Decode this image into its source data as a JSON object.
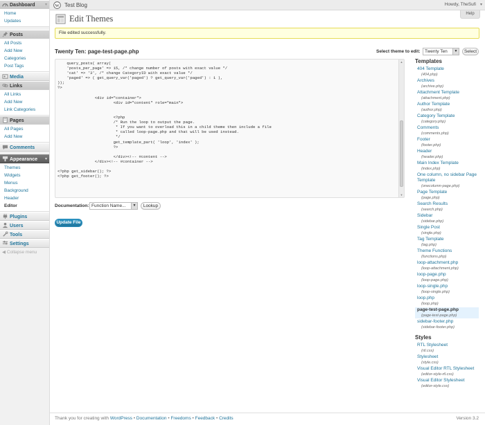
{
  "menu": {
    "dashboard": {
      "label": "Dashboard",
      "subs": [
        "Home",
        "Updates"
      ]
    },
    "posts": {
      "label": "Posts",
      "subs": [
        "All Posts",
        "Add New",
        "Categories",
        "Post Tags"
      ]
    },
    "media": {
      "label": "Media"
    },
    "links": {
      "label": "Links",
      "subs": [
        "All Links",
        "Add New",
        "Link Categories"
      ]
    },
    "pages": {
      "label": "Pages",
      "subs": [
        "All Pages",
        "Add New"
      ]
    },
    "comments": {
      "label": "Comments"
    },
    "appearance": {
      "label": "Appearance",
      "subs": [
        "Themes",
        "Widgets",
        "Menus",
        "Background",
        "Header",
        "Editor"
      ]
    },
    "plugins": {
      "label": "Plugins"
    },
    "users": {
      "label": "Users"
    },
    "tools": {
      "label": "Tools"
    },
    "settings": {
      "label": "Settings"
    },
    "collapse": "Collapse menu"
  },
  "header": {
    "site_title": "Test Blog",
    "howdy": "Howdy, TheSufi"
  },
  "page": {
    "title": "Edit Themes",
    "help": "Help",
    "notice": "File edited successfully.",
    "file_title": "Twenty Ten: page-test-page.php",
    "select_label": "Select theme to edit:",
    "selected_theme": "Twenty Ten",
    "select_button": "Select",
    "code": "    query_posts( array(\n    'posts_per_page' => 15, /* change number of posts with exact value */\n    'cat' => '3', /* change CategoryID with exact value */\n    'paged' => ( get_query_var('paged') ? get_query_var('paged') : 1 ),\n));\n?>\n\n                <div id=\"container\">\n                        <div id=\"content\" role=\"main\">\n\n\n                        <?php\n                        /* Run the loop to output the page.\n                         * If you want to overload this in a child theme then include a file\n                         * called loop-page.php and that will be used instead.\n                         */\n                        get_template_part( 'loop', 'index' );\n                        ?>\n\n                        </div><!-- #content -->\n                </div><!-- #container -->\n\n<?php get_sidebar(); ?>\n<?php get_footer(); ?>",
    "doc_label": "Documentation:",
    "doc_selected": "Function Name...",
    "lookup_button": "Lookup",
    "update_button": "Update File"
  },
  "sidebar": {
    "templates_heading": "Templates",
    "templates": [
      {
        "name": "404 Template",
        "file": "(404.php)"
      },
      {
        "name": "Archives",
        "file": "(archive.php)"
      },
      {
        "name": "Attachment Template",
        "file": "(attachment.php)"
      },
      {
        "name": "Author Template",
        "file": "(author.php)"
      },
      {
        "name": "Category Template",
        "file": "(category.php)"
      },
      {
        "name": "Comments",
        "file": "(comments.php)"
      },
      {
        "name": "Footer",
        "file": "(footer.php)"
      },
      {
        "name": "Header",
        "file": "(header.php)"
      },
      {
        "name": "Main Index Template",
        "file": "(index.php)"
      },
      {
        "name": "One column, no sidebar Page Template",
        "file": "(onecolumn-page.php)"
      },
      {
        "name": "Page Template",
        "file": "(page.php)"
      },
      {
        "name": "Search Results",
        "file": "(search.php)"
      },
      {
        "name": "Sidebar",
        "file": "(sidebar.php)"
      },
      {
        "name": "Single Post",
        "file": "(single.php)"
      },
      {
        "name": "Tag Template",
        "file": "(tag.php)"
      },
      {
        "name": "Theme Functions",
        "file": "(functions.php)"
      },
      {
        "name": "loop-attachment.php",
        "file": "(loop-attachment.php)"
      },
      {
        "name": "loop-page.php",
        "file": "(loop-page.php)"
      },
      {
        "name": "loop-single.php",
        "file": "(loop-single.php)"
      },
      {
        "name": "loop.php",
        "file": "(loop.php)"
      },
      {
        "name": "page-test-page.php",
        "file": "(page-test-page.php)"
      },
      {
        "name": "sidebar-footer.php",
        "file": "(sidebar-footer.php)"
      }
    ],
    "styles_heading": "Styles",
    "styles": [
      {
        "name": "RTL Stylesheet",
        "file": "(rtl.css)"
      },
      {
        "name": "Stylesheet",
        "file": "(style.css)"
      },
      {
        "name": "Visual Editor RTL Stylesheet",
        "file": "(editor-style-rtl.css)"
      },
      {
        "name": "Visual Editor Stylesheet",
        "file": "(editor-style.css)"
      }
    ]
  },
  "footer": {
    "thanks": "Thank you for creating with",
    "wordpress": "WordPress",
    "sep": "•",
    "documentation": "Documentation",
    "freedoms": "Freedoms",
    "feedback": "Feedback",
    "credits": "Credits",
    "version": "Version 3.2"
  },
  "colors": {
    "link": "#21759b",
    "notice_bg": "#ffffe0",
    "primary_button": "#21759b",
    "current_menu": "#6d6d6d"
  }
}
